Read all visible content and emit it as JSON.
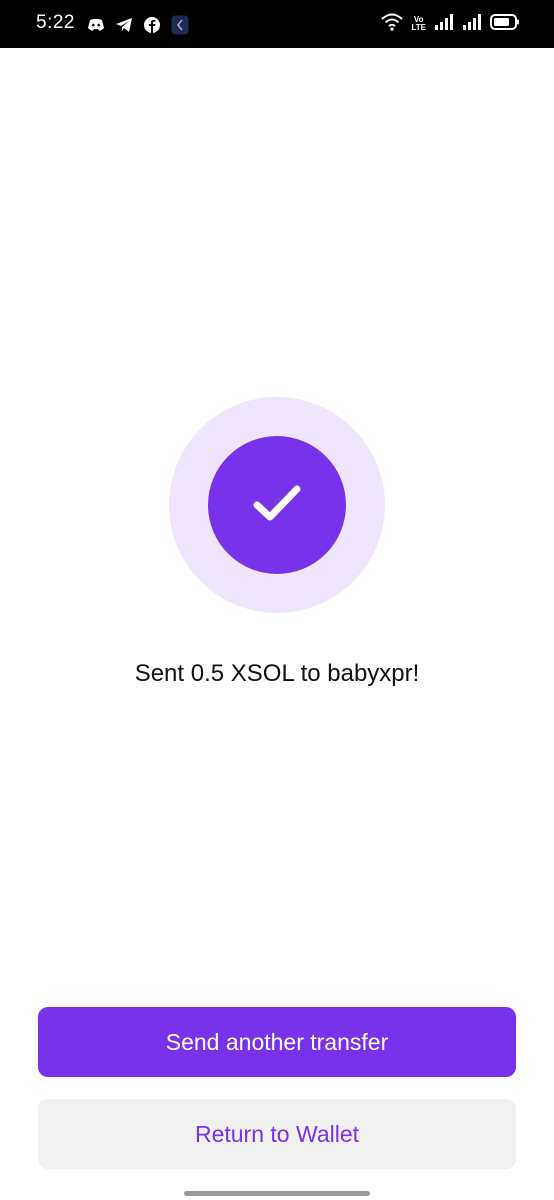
{
  "status_bar": {
    "time": "5:22",
    "left_icons": [
      "discord-icon",
      "telegram-icon",
      "facebook-icon",
      "app-back-icon"
    ],
    "right_icons": [
      "wifi-icon",
      "volte-icon",
      "signal-icon",
      "signal-icon",
      "battery-icon"
    ],
    "volte_top": "Vo",
    "volte_bottom": "LTE"
  },
  "success": {
    "icon": "checkmark-icon",
    "message": "Sent 0.5 XSOL to babyxpr!"
  },
  "actions": {
    "primary_label": "Send another transfer",
    "secondary_label": "Return to Wallet"
  },
  "colors": {
    "accent": "#7a31ea",
    "accent_light": "#efe6fd",
    "secondary_bg": "#f1f1f1"
  }
}
